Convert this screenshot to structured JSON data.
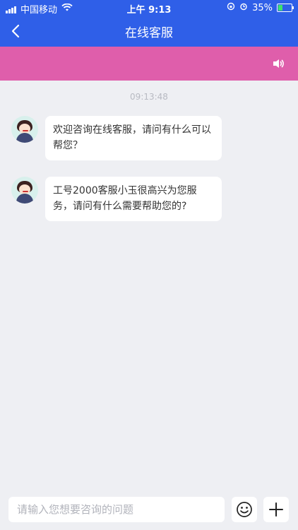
{
  "status_bar": {
    "carrier": "中国移动",
    "time": "上午 9:13",
    "battery": "35%",
    "battery_level": 0.35
  },
  "navbar": {
    "title": "在线客服"
  },
  "chat": {
    "timestamp": "09:13:48",
    "messages": [
      {
        "text": "欢迎咨询在线客服，请问有什么可以帮您？"
      },
      {
        "text": "工号2000客服小玉很高兴为您服务，请问有什么需要帮助您的?"
      }
    ]
  },
  "input": {
    "placeholder": "请输入您想要咨询的问题"
  },
  "colors": {
    "header": "#2f5fe8",
    "banner": "#df5eab",
    "background": "#eeeff3"
  },
  "icons": {
    "back": "back-icon",
    "speaker": "speaker-icon",
    "emoji": "emoji-icon",
    "add": "plus-icon",
    "signal": "signal-icon",
    "wifi": "wifi-icon",
    "battery": "battery-icon"
  }
}
